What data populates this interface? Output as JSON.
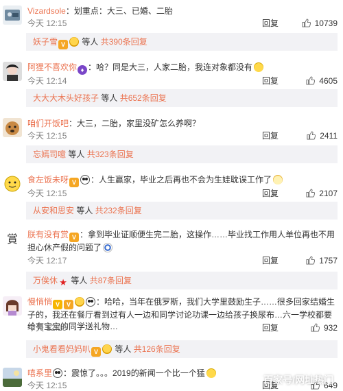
{
  "comments": [
    {
      "user": "Vizardsole",
      "text": "：划重点：大三、已婚、二胎",
      "time": "今天 12:15",
      "reply": "回复",
      "likes": "10739",
      "sub": {
        "user": "妖子雪",
        "text": " 等人 ",
        "count": "共390条回复"
      }
    },
    {
      "user": "阿狸不喜欢你",
      "text": "：哈？同是大三，人家二胎，我连对象都没有",
      "time": "今天 12:14",
      "reply": "回复",
      "likes": "4605",
      "sub": {
        "user": "大大大木头好孩子",
        "text": " 等人 ",
        "count": "共652条回复"
      }
    },
    {
      "user": "咱们开饭吧",
      "text": "：大三，二胎，家里没矿怎么养啊？",
      "time": "今天 12:15",
      "reply": "回复",
      "likes": "2411",
      "sub": {
        "user": "忘嫣司噫",
        "text": " 等人 ",
        "count": "共323条回复"
      }
    },
    {
      "user": "食左饭未呀",
      "text": "：人生赢家，毕业之后再也不会为生娃耽误工作了",
      "time": "今天 12:15",
      "reply": "回复",
      "likes": "2107",
      "sub": {
        "user": "从安和思安",
        "text": " 等人 ",
        "count": "共232条回复"
      }
    },
    {
      "user": "朕有没有赏",
      "text": "：拿到毕业证顺便生完二胎，这操作……毕业找工作用人单位再也不用担心休产假的问题了",
      "time": "今天 12:17",
      "reply": "回复",
      "likes": "1757",
      "sub": {
        "user": "万俟休",
        "text": " 等人 ",
        "count": "共87条回复"
      }
    },
    {
      "user": "慢悄悄",
      "text": "：哈哈，当年在俄罗斯，我们大学里鼓励生子……很多回家结婚生子的，我还在餐厅看到过有人一边和同学讨论功课一边给孩子换尿布…六一学校都要给有宝宝的同学送礼物…",
      "time": "今天 12:15",
      "reply": "回复",
      "likes": "932",
      "sub": {
        "user": "小鬼看看妈妈叭",
        "text": " 等人 ",
        "count": "共126条回复"
      }
    },
    {
      "user": "嘻系里",
      "text": "：震惊了。。。2019的新闻一个比一个猛",
      "time": "今天 12:15",
      "reply": "回复",
      "likes": "649",
      "sub": null
    }
  ],
  "watermark": "百家号/网址热门",
  "icons": {
    "like": "thumbs-up-icon"
  },
  "colors": {
    "username": "#eb7350",
    "subbar": "#f2f2f5",
    "meta": "#808080"
  }
}
